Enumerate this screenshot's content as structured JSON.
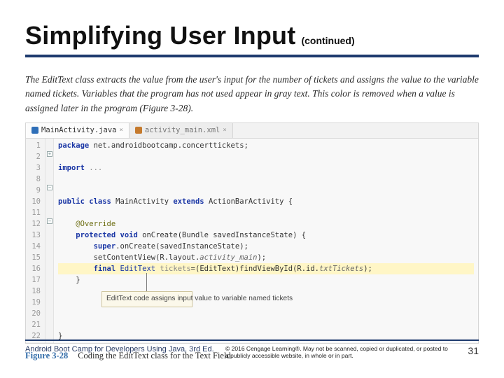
{
  "header": {
    "title": "Simplifying User Input",
    "continued": "(continued)"
  },
  "body_paragraph": "The EditText class extracts the value from the user's input for the number of tickets and assigns the value to the variable named tickets. Variables that the program has not used appear in gray text. This color is removed when a value is assigned later in the program (Figure 3-28).",
  "ide": {
    "tabs": {
      "active": "MainActivity.java",
      "inactive": "activity_main.xml"
    },
    "line_numbers": [
      "1",
      "2",
      "3",
      "8",
      "9",
      "10",
      "11",
      "12",
      "13",
      "14",
      "15",
      "16",
      "17",
      "18",
      "19",
      "20",
      "21",
      "22"
    ],
    "code": {
      "l1_kw": "package",
      "l1_rest": " net.androidbootcamp.concerttickets;",
      "l2_kw": "import",
      "l2_rest": " ...",
      "l10a": "public class",
      "l10b": " MainActivity ",
      "l10c": "extends",
      "l10d": " ActionBarActivity {",
      "l12": "@Override",
      "l13a": "protected void",
      "l13b": " onCreate(Bundle savedInstanceState) {",
      "l14a": "super",
      "l14b": ".onCreate(savedInstanceState);",
      "l15a": "setContentView(R.layout.",
      "l15b": "activity_main",
      "l15c": ");",
      "l16a": "final ",
      "l16b": "EditText",
      "l16c": " tickets",
      "l16d": "=(EditText)findViewById(R.id.",
      "l16e": "txtTickets",
      "l16f": ");",
      "l17": "}",
      "l22": "}"
    },
    "callout": "EditText code assigns input value to variable named tickets"
  },
  "figure": {
    "number": "Figure 3-28",
    "caption": "Coding the EditText class for the Text Field"
  },
  "footer": {
    "left": "Android Boot Camp for Developers Using Java, 3rd Ed.",
    "copyright": "© 2016 Cengage Learning®. May not be scanned, copied or duplicated, or posted to a publicly accessible website, in whole or in part.",
    "page": "31"
  }
}
